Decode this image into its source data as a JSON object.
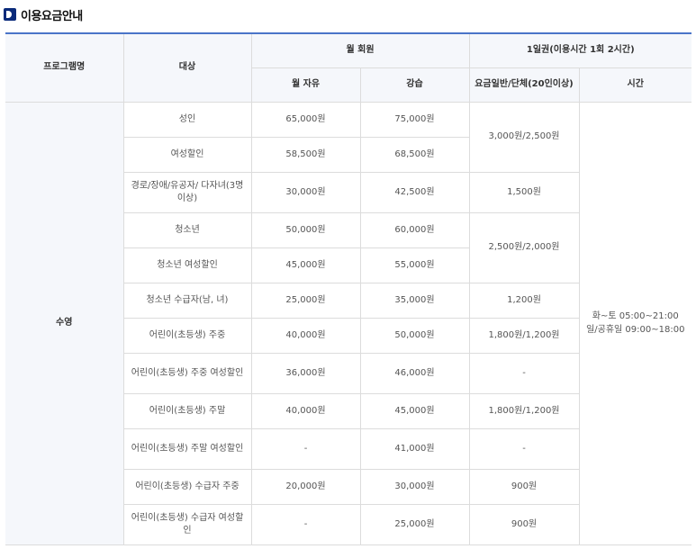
{
  "page": {
    "title": "이용요금안내"
  },
  "headers": {
    "program": "프로그램명",
    "target": "대상",
    "monthly": "월 회원",
    "monthly_free": "월 자유",
    "monthly_lesson": "강습",
    "daily": "1일권(이용시간 1회 2시간)",
    "daily_fee": "요금일반/단체(20인이상)",
    "daily_time": "시간"
  },
  "program_name": "수영",
  "hours": [
    "화~토 05:00~21:00",
    "일/공휴일 09:00~18:00"
  ],
  "rows": [
    {
      "target": "성인",
      "free": "65,000원",
      "lesson": "75,000원"
    },
    {
      "target": "여성할인",
      "free": "58,500원",
      "lesson": "68,500원"
    },
    {
      "target": "경로/장애/유공자/ 다자녀(3명이상)",
      "free": "30,000원",
      "lesson": "42,500원",
      "daily": "1,500원"
    },
    {
      "target": "청소년",
      "free": "50,000원",
      "lesson": "60,000원"
    },
    {
      "target": "청소년 여성할인",
      "free": "45,000원",
      "lesson": "55,000원"
    },
    {
      "target": "청소년 수급자(남, 녀)",
      "free": "25,000원",
      "lesson": "35,000원",
      "daily": "1,200원"
    },
    {
      "target": "어린이(초등생) 주중",
      "free": "40,000원",
      "lesson": "50,000원",
      "daily": "1,800원/1,200원"
    },
    {
      "target": "어린이(초등생) 주중 여성할인",
      "free": "36,000원",
      "lesson": "46,000원",
      "daily": "-"
    },
    {
      "target": "어린이(초등생) 주말",
      "free": "40,000원",
      "lesson": "45,000원",
      "daily": "1,800원/1,200원"
    },
    {
      "target": "어린이(초등생) 주말 여성할인",
      "free": "-",
      "lesson": "41,000원",
      "daily": "-"
    },
    {
      "target": "어린이(초등생) 수급자 주중",
      "free": "20,000원",
      "lesson": "30,000원",
      "daily": "900원"
    },
    {
      "target": "어린이(초등생) 수급자 여성할인",
      "free": "-",
      "lesson": "25,000원",
      "daily": "900원"
    }
  ],
  "merged_daily": {
    "adult": "3,000원/2,500원",
    "youth": "2,500원/2,000원"
  }
}
